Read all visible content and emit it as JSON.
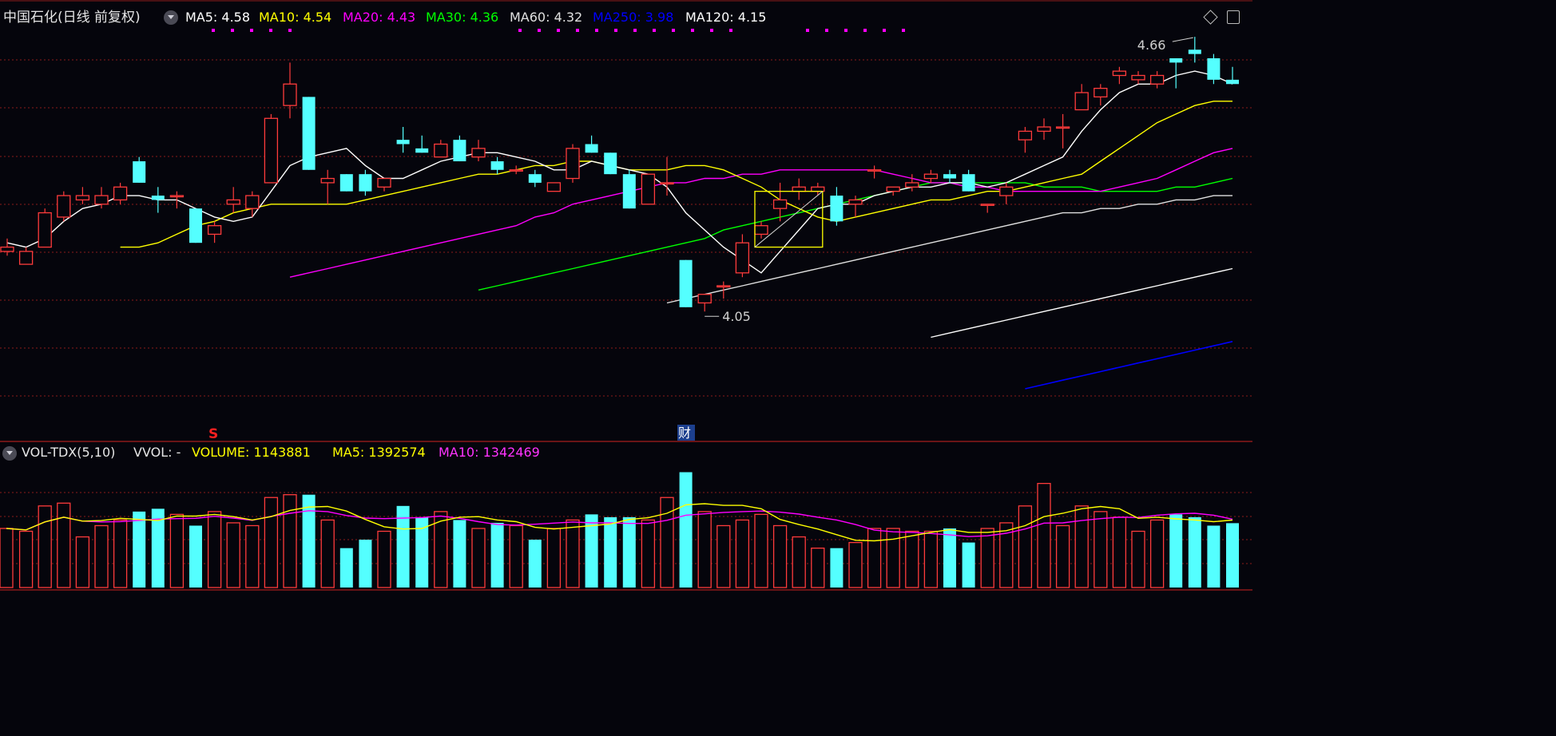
{
  "main_panel": {
    "title": "中国石化(日线 前复权)",
    "ma_legend": [
      {
        "label": "MA5:",
        "value": "4.58",
        "color": "#ffffff"
      },
      {
        "label": "MA10:",
        "value": "4.54",
        "color": "#ffff00"
      },
      {
        "label": "MA20:",
        "value": "4.43",
        "color": "#ff00ff"
      },
      {
        "label": "MA30:",
        "value": "4.36",
        "color": "#00ff00"
      },
      {
        "label": "MA60:",
        "value": "4.32",
        "color": "#e0e0e0"
      },
      {
        "label": "MA250:",
        "value": "3.98",
        "color": "#0000ff"
      },
      {
        "label": "MA120:",
        "value": "4.15",
        "color": "#ffffff"
      }
    ],
    "high_label": "4.66",
    "low_label": "4.05",
    "markers": [
      {
        "text": "S",
        "color": "#ff2020"
      },
      {
        "text": "财",
        "color": "#ffffff"
      }
    ]
  },
  "volume_panel": {
    "title": "VOL-TDX(5,10)",
    "vvol_label": "VVOL: -",
    "volume_label": "VOLUME:",
    "volume_value": "1143881",
    "ma5_label": "MA5:",
    "ma5_value": "1392574",
    "ma10_label": "MA10:",
    "ma10_value": "1342469"
  },
  "colors": {
    "up": "#ff3b3b",
    "down": "#54ffff",
    "ma5": "#ffffff",
    "ma10": "#ffff00",
    "ma20": "#ff00ff",
    "ma30": "#00ff00",
    "ma60": "#e0e0e0",
    "ma120": "#ffffff",
    "ma250": "#0000ff",
    "grid": "#8b1a1a"
  },
  "chart_data": {
    "type": "candlestick",
    "x": [
      1,
      2,
      3,
      4,
      5,
      6,
      7,
      8,
      9,
      10,
      11,
      12,
      13,
      14,
      15,
      16,
      17,
      18,
      19,
      20,
      21,
      22,
      23,
      24,
      25,
      26,
      27,
      28,
      29,
      30,
      31,
      32,
      33,
      34,
      35,
      36,
      37,
      38,
      39,
      40,
      41,
      42,
      43,
      44,
      45,
      46,
      47,
      48,
      49,
      50,
      51,
      52,
      53,
      54,
      55,
      56,
      57,
      58,
      59,
      60,
      61,
      62,
      63,
      64,
      65
    ],
    "ohlc": [
      [
        4.19,
        4.22,
        4.18,
        4.2
      ],
      [
        4.16,
        4.2,
        4.16,
        4.19
      ],
      [
        4.2,
        4.29,
        4.2,
        4.28
      ],
      [
        4.27,
        4.33,
        4.26,
        4.32
      ],
      [
        4.31,
        4.34,
        4.3,
        4.32
      ],
      [
        4.3,
        4.34,
        4.29,
        4.32
      ],
      [
        4.31,
        4.35,
        4.3,
        4.34
      ],
      [
        4.4,
        4.41,
        4.35,
        4.35
      ],
      [
        4.32,
        4.34,
        4.28,
        4.31
      ],
      [
        4.32,
        4.33,
        4.29,
        4.32
      ],
      [
        4.29,
        4.29,
        4.21,
        4.21
      ],
      [
        4.23,
        4.26,
        4.21,
        4.25
      ],
      [
        4.3,
        4.34,
        4.28,
        4.31
      ],
      [
        4.29,
        4.33,
        4.27,
        4.32
      ],
      [
        4.35,
        4.51,
        4.35,
        4.5
      ],
      [
        4.53,
        4.63,
        4.5,
        4.58
      ],
      [
        4.55,
        4.55,
        4.38,
        4.38
      ],
      [
        4.35,
        4.38,
        4.3,
        4.36
      ],
      [
        4.37,
        4.37,
        4.33,
        4.33
      ],
      [
        4.37,
        4.38,
        4.32,
        4.33
      ],
      [
        4.34,
        4.36,
        4.33,
        4.36
      ],
      [
        4.45,
        4.48,
        4.42,
        4.44
      ],
      [
        4.43,
        4.46,
        4.42,
        4.42
      ],
      [
        4.41,
        4.45,
        4.41,
        4.44
      ],
      [
        4.45,
        4.46,
        4.4,
        4.4
      ],
      [
        4.41,
        4.45,
        4.4,
        4.43
      ],
      [
        4.4,
        4.41,
        4.37,
        4.38
      ],
      [
        4.38,
        4.39,
        4.37,
        4.38
      ],
      [
        4.37,
        4.38,
        4.34,
        4.35
      ],
      [
        4.33,
        4.35,
        4.33,
        4.35
      ],
      [
        4.36,
        4.44,
        4.35,
        4.43
      ],
      [
        4.44,
        4.46,
        4.42,
        4.42
      ],
      [
        4.42,
        4.42,
        4.37,
        4.37
      ],
      [
        4.37,
        4.38,
        4.29,
        4.29
      ],
      [
        4.3,
        4.37,
        4.3,
        4.37
      ],
      [
        4.35,
        4.41,
        4.32,
        4.35
      ],
      [
        4.17,
        4.17,
        4.06,
        4.06
      ],
      [
        4.07,
        4.09,
        4.05,
        4.09
      ],
      [
        4.11,
        4.12,
        4.08,
        4.11
      ],
      [
        4.14,
        4.23,
        4.13,
        4.21
      ],
      [
        4.23,
        4.26,
        4.22,
        4.25
      ],
      [
        4.29,
        4.35,
        4.26,
        4.31
      ],
      [
        4.33,
        4.36,
        4.31,
        4.34
      ],
      [
        4.33,
        4.35,
        4.32,
        4.34
      ],
      [
        4.32,
        4.34,
        4.25,
        4.26
      ],
      [
        4.3,
        4.32,
        4.27,
        4.31
      ],
      [
        4.38,
        4.39,
        4.36,
        4.38
      ],
      [
        4.33,
        4.34,
        4.32,
        4.34
      ],
      [
        4.34,
        4.37,
        4.33,
        4.35
      ],
      [
        4.36,
        4.38,
        4.35,
        4.37
      ],
      [
        4.37,
        4.38,
        4.35,
        4.36
      ],
      [
        4.37,
        4.38,
        4.33,
        4.33
      ],
      [
        4.3,
        4.3,
        4.28,
        4.3
      ],
      [
        4.32,
        4.35,
        4.3,
        4.34
      ],
      [
        4.45,
        4.48,
        4.42,
        4.47
      ],
      [
        4.47,
        4.5,
        4.45,
        4.48
      ],
      [
        4.48,
        4.51,
        4.43,
        4.48
      ],
      [
        4.52,
        4.58,
        4.52,
        4.56
      ],
      [
        4.55,
        4.58,
        4.53,
        4.57
      ],
      [
        4.6,
        4.62,
        4.58,
        4.61
      ],
      [
        4.59,
        4.61,
        4.58,
        4.6
      ],
      [
        4.58,
        4.61,
        4.57,
        4.6
      ],
      [
        4.64,
        4.64,
        4.57,
        4.63
      ],
      [
        4.66,
        4.69,
        4.63,
        4.65
      ],
      [
        4.64,
        4.65,
        4.58,
        4.59
      ],
      [
        4.59,
        4.62,
        4.58,
        4.58
      ]
    ],
    "ma5": [
      4.21,
      4.2,
      4.22,
      4.26,
      4.29,
      4.3,
      4.32,
      4.32,
      4.31,
      4.31,
      4.29,
      4.27,
      4.26,
      4.27,
      4.33,
      4.39,
      4.41,
      4.42,
      4.43,
      4.39,
      4.36,
      4.36,
      4.38,
      4.4,
      4.41,
      4.42,
      4.42,
      4.41,
      4.4,
      4.38,
      4.38,
      4.4,
      4.39,
      4.38,
      4.37,
      4.34,
      4.28,
      4.24,
      4.2,
      4.17,
      4.14,
      4.19,
      4.24,
      4.29,
      4.3,
      4.3,
      4.32,
      4.33,
      4.34,
      4.34,
      4.35,
      4.35,
      4.34,
      4.35,
      4.37,
      4.39,
      4.41,
      4.47,
      4.52,
      4.56,
      4.58,
      4.58,
      4.6,
      4.61,
      4.6,
      4.58
    ],
    "ma10": [
      4.2,
      4.2,
      4.21,
      4.23,
      4.25,
      4.26,
      4.28,
      4.29,
      4.3,
      4.3,
      4.3,
      4.3,
      4.3,
      4.31,
      4.32,
      4.33,
      4.34,
      4.35,
      4.36,
      4.37,
      4.37,
      4.38,
      4.39,
      4.39,
      4.4,
      4.4,
      4.39,
      4.38,
      4.38,
      4.38,
      4.39,
      4.39,
      4.38,
      4.36,
      4.34,
      4.31,
      4.29,
      4.27,
      4.26,
      4.27,
      4.28,
      4.29,
      4.3,
      4.31,
      4.31,
      4.32,
      4.33,
      4.33,
      4.34,
      4.35,
      4.36,
      4.37,
      4.4,
      4.43,
      4.46,
      4.49,
      4.51,
      4.53,
      4.54,
      4.54
    ],
    "ma20": [
      4.13,
      4.14,
      4.15,
      4.16,
      4.17,
      4.18,
      4.19,
      4.2,
      4.21,
      4.22,
      4.23,
      4.24,
      4.25,
      4.27,
      4.28,
      4.3,
      4.31,
      4.32,
      4.33,
      4.34,
      4.35,
      4.35,
      4.36,
      4.36,
      4.37,
      4.37,
      4.38,
      4.38,
      4.38,
      4.38,
      4.38,
      4.38,
      4.37,
      4.36,
      4.35,
      4.35,
      4.34,
      4.34,
      4.33,
      4.33,
      4.33,
      4.33,
      4.33,
      4.33,
      4.34,
      4.35,
      4.36,
      4.38,
      4.4,
      4.42,
      4.43
    ],
    "ma30": [
      4.1,
      4.11,
      4.12,
      4.13,
      4.14,
      4.15,
      4.16,
      4.17,
      4.18,
      4.19,
      4.2,
      4.21,
      4.22,
      4.24,
      4.25,
      4.26,
      4.27,
      4.28,
      4.29,
      4.3,
      4.31,
      4.32,
      4.33,
      4.34,
      4.35,
      4.35,
      4.35,
      4.35,
      4.35,
      4.35,
      4.34,
      4.34,
      4.34,
      4.33,
      4.33,
      4.33,
      4.33,
      4.34,
      4.34,
      4.35,
      4.36
    ],
    "ma60": [
      4.07,
      4.08,
      4.09,
      4.1,
      4.11,
      4.12,
      4.13,
      4.14,
      4.15,
      4.16,
      4.17,
      4.18,
      4.19,
      4.2,
      4.21,
      4.22,
      4.23,
      4.24,
      4.25,
      4.26,
      4.27,
      4.28,
      4.28,
      4.29,
      4.29,
      4.3,
      4.3,
      4.31,
      4.31,
      4.32,
      4.32
    ],
    "ma120": [
      3.99,
      4.0,
      4.01,
      4.02,
      4.03,
      4.04,
      4.05,
      4.06,
      4.07,
      4.08,
      4.09,
      4.1,
      4.11,
      4.12,
      4.13,
      4.14,
      4.15
    ],
    "ma250": [
      3.87,
      3.88,
      3.89,
      3.9,
      3.91,
      3.92,
      3.93,
      3.94,
      3.95,
      3.96,
      3.97,
      3.98
    ],
    "volume": [
      1050000,
      1000000,
      1450000,
      1500000,
      900000,
      1100000,
      1200000,
      1350000,
      1400000,
      1300000,
      1100000,
      1350000,
      1150000,
      1100000,
      1600000,
      1650000,
      1650000,
      1200000,
      700000,
      850000,
      1000000,
      1450000,
      1250000,
      1350000,
      1200000,
      1050000,
      1150000,
      1100000,
      850000,
      1050000,
      1200000,
      1300000,
      1250000,
      1250000,
      1200000,
      1600000,
      2050000,
      1350000,
      1100000,
      1200000,
      1300000,
      1100000,
      900000,
      700000,
      700000,
      800000,
      1050000,
      1050000,
      1000000,
      1000000,
      1050000,
      800000,
      1050000,
      1150000,
      1450000,
      1850000,
      1100000,
      1450000,
      1350000,
      1250000,
      1000000,
      1200000,
      1300000,
      1250000,
      1100000,
      1143881
    ]
  }
}
